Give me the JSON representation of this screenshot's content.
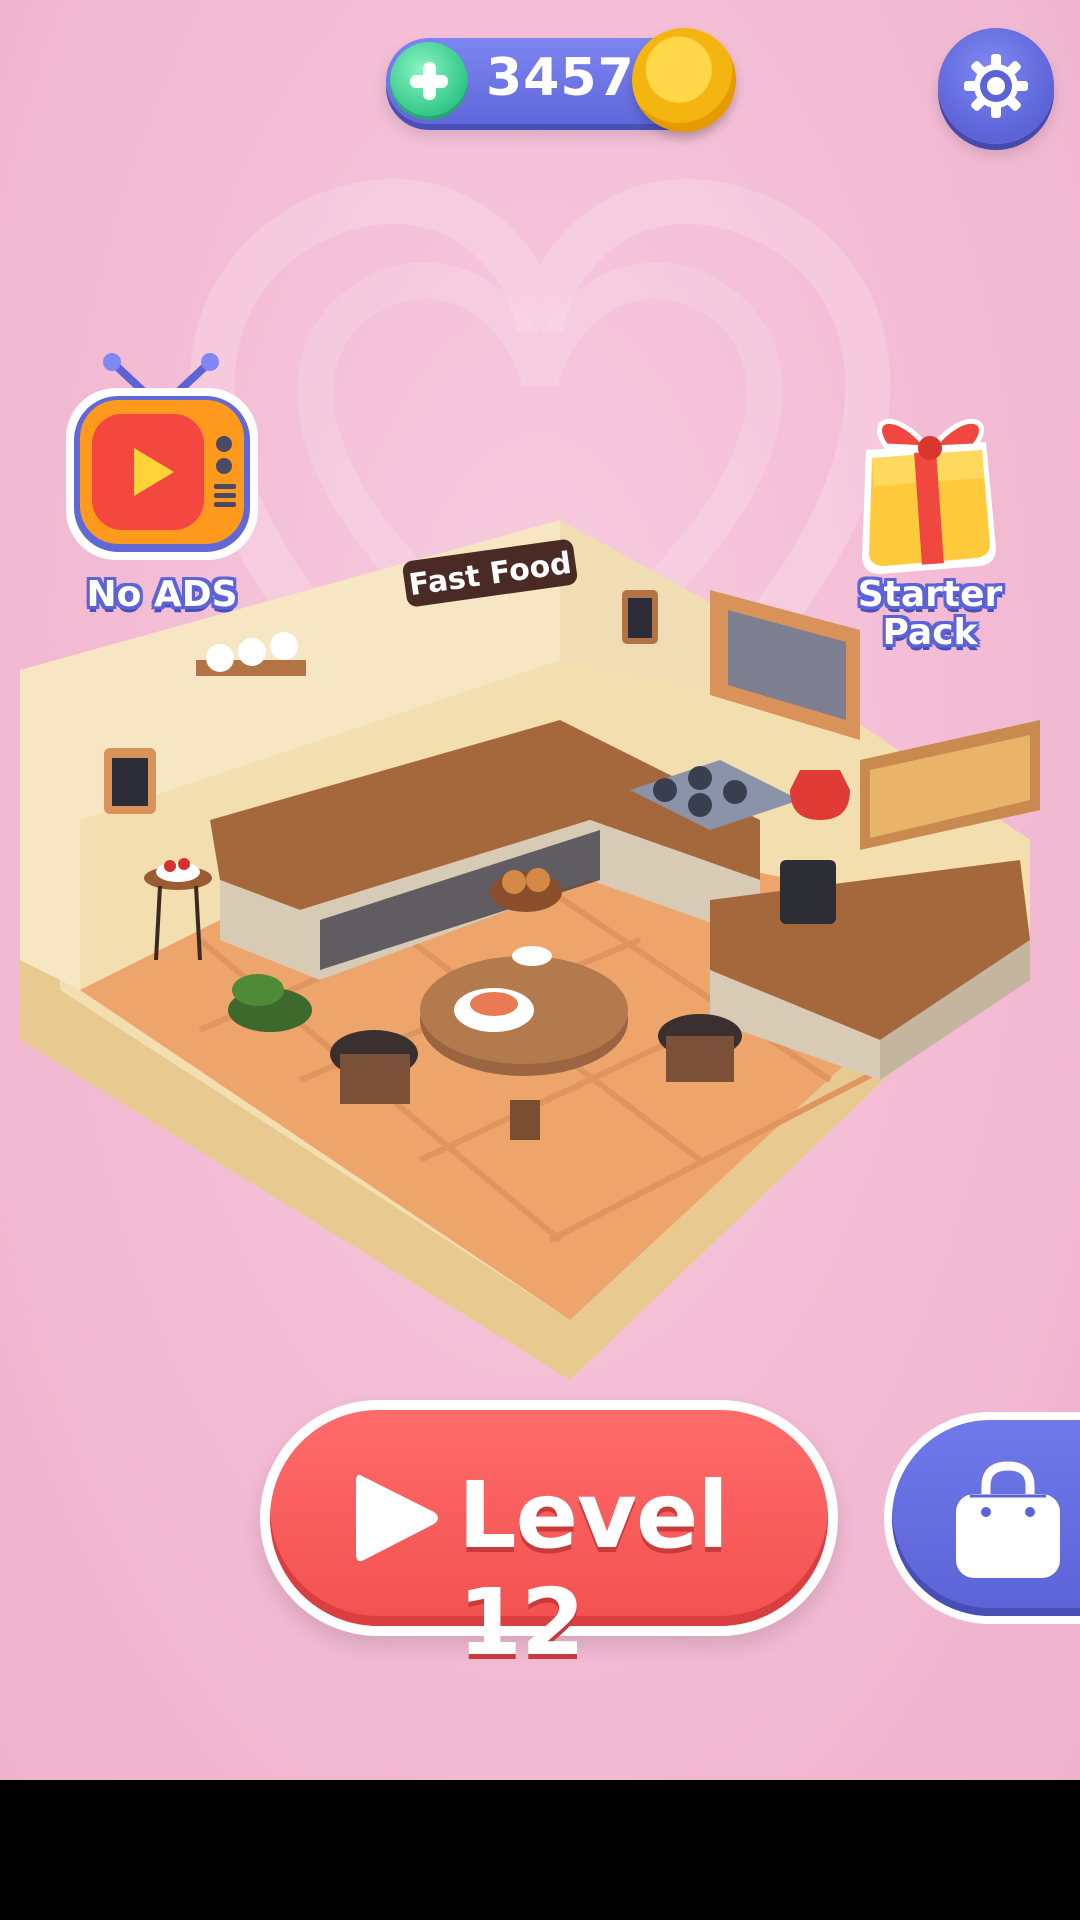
{
  "currency": {
    "coins": "3457",
    "add_icon": "plus-icon",
    "coin_icon": "gold-coin-icon",
    "colors": {
      "bar": "#6a73e3",
      "plus": "#35c98a",
      "coin": "#f4b510"
    }
  },
  "settings": {
    "icon": "gear-icon"
  },
  "no_ads": {
    "label": "No ADS",
    "icon": "tv-play-icon"
  },
  "starter_pack": {
    "label": "Starter\nPack",
    "icon": "gift-box-icon"
  },
  "room": {
    "sign_text": "Fast Food"
  },
  "play": {
    "label": "Level 12",
    "icon": "play-triangle-icon",
    "color": "#f2514f"
  },
  "shop": {
    "icon": "shopping-bag-icon",
    "color": "#5b63d6"
  }
}
